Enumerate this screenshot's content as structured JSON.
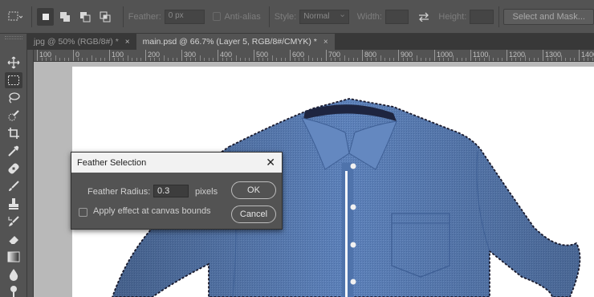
{
  "options_bar": {
    "feather_label": "Feather:",
    "feather_value": "0 px",
    "antialias_label": "Anti-alias",
    "style_label": "Style:",
    "style_value": "Normal",
    "width_label": "Width:",
    "height_label": "Height:",
    "select_mask_label": "Select and Mask..."
  },
  "tabs": [
    {
      "label": "jpg @ 50% (RGB/8#) *",
      "close": "×",
      "active": false
    },
    {
      "label": "main.psd @ 66.7% (Layer 5, RGB/8#/CMYK) *",
      "close": "×",
      "active": true
    }
  ],
  "ruler": {
    "ticks": [
      "100",
      "0",
      "100",
      "200",
      "300",
      "400",
      "500",
      "600",
      "700",
      "800",
      "900",
      "1000",
      "1100",
      "1200",
      "1300",
      "1400"
    ]
  },
  "toolbar": {
    "tools": [
      "move-tool",
      "rectangular-marquee-tool",
      "lasso-tool",
      "quick-selection-tool",
      "crop-tool",
      "eyedropper-tool",
      "healing-brush-tool",
      "brush-tool",
      "clone-stamp-tool",
      "history-brush-tool",
      "eraser-tool",
      "gradient-tool",
      "blur-tool",
      "dodge-tool"
    ]
  },
  "dialog": {
    "title": "Feather Selection",
    "close": "✕",
    "radius_label": "Feather Radius:",
    "radius_value": "0.3",
    "unit_label": "pixels",
    "checkbox_label": "Apply effect at canvas bounds",
    "ok_label": "OK",
    "cancel_label": "Cancel"
  },
  "colors": {
    "shirt": "#5b7fb8",
    "canvas_bg": "#ffffff",
    "pasteboard": "#b9b9b9"
  }
}
